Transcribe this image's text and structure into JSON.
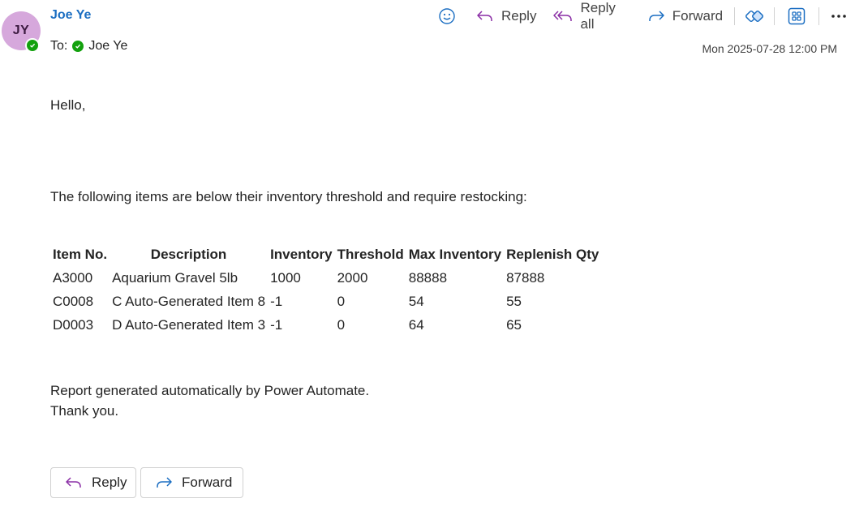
{
  "sender": {
    "initials": "JY",
    "name": "Joe Ye"
  },
  "recipients": {
    "to_label": "To:",
    "to_name": "Joe Ye"
  },
  "timestamp": "Mon 2025-07-28 12:00 PM",
  "toolbar": {
    "emoji_icon": "emoji-icon",
    "reply_label": "Reply",
    "reply_all_label": "Reply all",
    "forward_label": "Forward",
    "loop_icon": "loop-icon",
    "apps_icon": "apps-icon",
    "more_icon": "more-icon"
  },
  "body": {
    "greeting": "Hello,",
    "intro": "The following items are below their inventory threshold and require restocking:",
    "table": {
      "headers": [
        "Item No.",
        "Description",
        "Inventory",
        "Threshold",
        "Max Inventory",
        "Replenish Qty"
      ],
      "rows": [
        [
          "A3000",
          "Aquarium Gravel 5lb",
          "1000",
          "2000",
          "88888",
          "87888"
        ],
        [
          "C0008",
          "C Auto-Generated Item 8",
          "-1",
          "0",
          "54",
          "55"
        ],
        [
          "D0003",
          "D Auto-Generated Item 3",
          "-1",
          "0",
          "64",
          "65"
        ]
      ]
    },
    "closing_line1": "Report generated automatically by Power Automate.",
    "closing_line2": "Thank you."
  },
  "actions": {
    "reply_label": "Reply",
    "forward_label": "Forward"
  },
  "colors": {
    "accent": "#1b6ec2",
    "avatar_bg": "#d6a8dc",
    "presence": "#13a10e",
    "reply_icon": "#8a2da5",
    "forward_icon": "#1b6ec2"
  }
}
